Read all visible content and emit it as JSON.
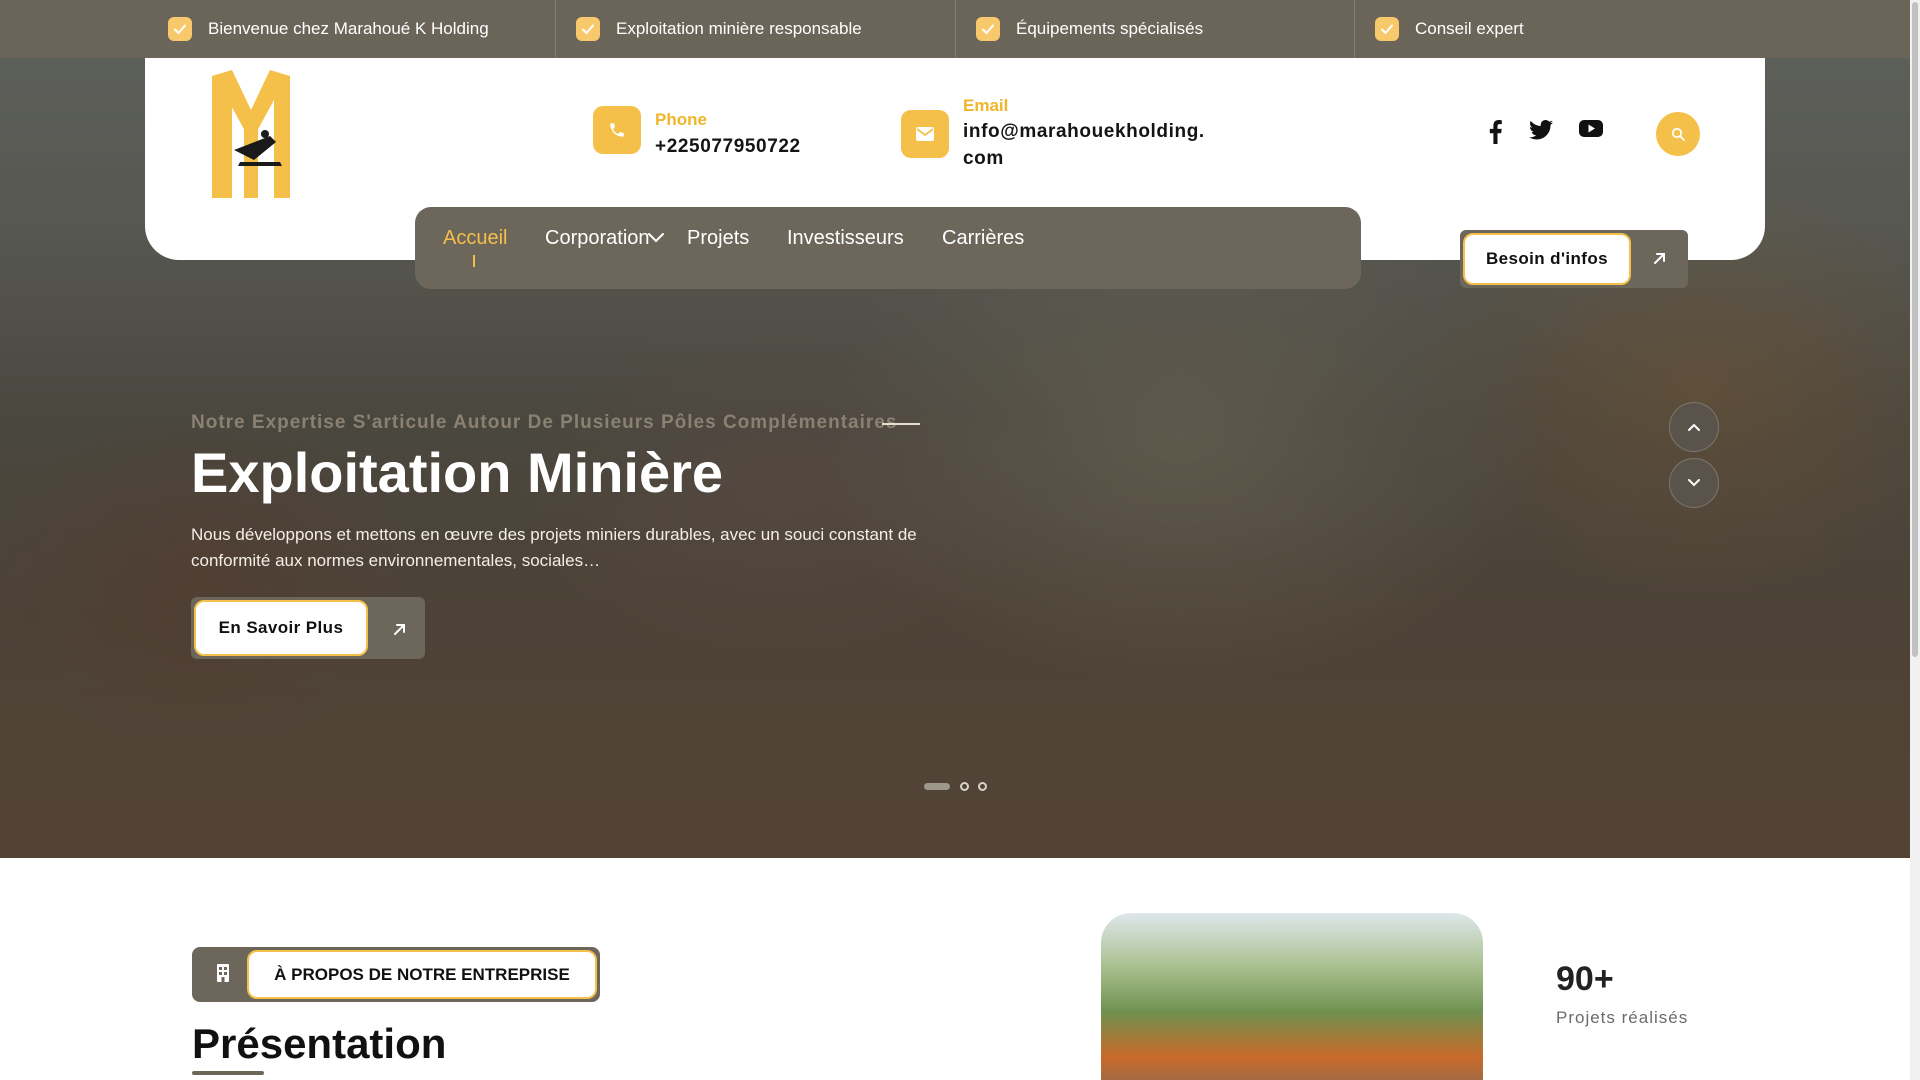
{
  "topbar": {
    "items": [
      {
        "label": "Bienvenue chez Marahoué K Holding"
      },
      {
        "label": "Exploitation minière responsable"
      },
      {
        "label": "Équipements spécialisés"
      },
      {
        "label": "Conseil expert"
      }
    ]
  },
  "header": {
    "phone": {
      "label": "Phone",
      "value": "+225077950722"
    },
    "email": {
      "label": "Email",
      "value_line1": "info@marahouekholding.",
      "value_line2": "com"
    },
    "social": [
      "facebook-icon",
      "twitter-icon",
      "youtube-icon"
    ]
  },
  "nav": {
    "items": [
      {
        "label": "Accueil",
        "active": true
      },
      {
        "label": "Corporation",
        "dropdown": true
      },
      {
        "label": "Projets"
      },
      {
        "label": "Investisseurs"
      },
      {
        "label": "Carrières"
      }
    ],
    "cta": "Besoin d'infos"
  },
  "hero": {
    "subtitle": "Notre Expertise S'articule Autour De Plusieurs Pôles Complémentaires",
    "title": "Exploitation Minière",
    "description": "Nous développons et mettons en œuvre des projets miniers durables, avec un souci constant de conformité aux normes environnementales, sociales…",
    "button": "En Savoir Plus",
    "slides": {
      "count": 3,
      "active": 1
    }
  },
  "about": {
    "badge": "À PROPOS DE NOTRE ENTREPRISE",
    "title": "Présentation",
    "stat": {
      "value": "90+",
      "label": "Projets réalisés"
    }
  },
  "colors": {
    "accent": "#f5c04a",
    "bar": "#6c665b",
    "text": "#111111"
  }
}
